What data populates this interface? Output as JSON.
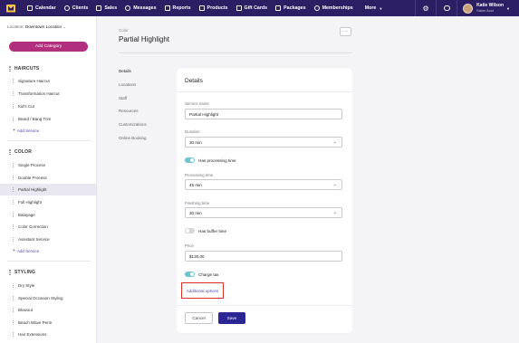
{
  "nav": {
    "items": [
      {
        "label": "Calendar",
        "icon": "calendar-icon"
      },
      {
        "label": "Clients",
        "icon": "clients-icon"
      },
      {
        "label": "Sales",
        "icon": "sales-icon"
      },
      {
        "label": "Messages",
        "icon": "messages-icon"
      },
      {
        "label": "Reports",
        "icon": "reports-icon"
      },
      {
        "label": "Products",
        "icon": "products-icon"
      },
      {
        "label": "Gift Cards",
        "icon": "gift-card-icon"
      },
      {
        "label": "Packages",
        "icon": "packages-icon"
      },
      {
        "label": "Memberships",
        "icon": "memberships-icon"
      }
    ],
    "more": "More",
    "user_name": "Katie Wilson",
    "user_role": "Salon Acct"
  },
  "sidebar": {
    "location_label": "Location:",
    "location_value": "Downtown Location",
    "add_category": "Add Category",
    "sections": [
      {
        "title": "HAIRCUTS",
        "items": [
          "Signature Haircut",
          "Transformation Haircut",
          "Kid's Cut",
          "Beard / Bang Trim"
        ],
        "add": "Add Service"
      },
      {
        "title": "COLOR",
        "items": [
          "Single Process",
          "Double Process",
          "Partial Highlight",
          "Full Highlight",
          "Balayage",
          "Color Correction",
          "Assistant Service"
        ],
        "add": "Add Service"
      },
      {
        "title": "STYLING",
        "items": [
          "Dry Style",
          "Special Occasion Styling",
          "Blowout",
          "Beach Wave Perm",
          "Hair Extensions"
        ]
      }
    ],
    "active_item": "Partial Highlight"
  },
  "main": {
    "breadcrumb": "Color",
    "title": "Partial Highlight",
    "more_button": "···",
    "subnav": [
      "Details",
      "Locations",
      "Staff",
      "Resources",
      "Customizations",
      "Online Booking"
    ],
    "details": {
      "heading": "Details",
      "service_name_label": "Service name",
      "service_name_value": "Partial Highlight",
      "duration_label": "Duration",
      "duration_value": "30 min",
      "has_processing_label": "Has processing time",
      "has_processing_on": true,
      "processing_label": "Processing time",
      "processing_value": "45 min",
      "finishing_label": "Finishing time",
      "finishing_value": "30 min",
      "has_buffer_label": "Has buffer time",
      "has_buffer_on": false,
      "price_label": "Price",
      "price_value": "$130.00",
      "charge_tax_label": "Charge tax",
      "charge_tax_on": true,
      "additional_options": "Additional options",
      "cancel": "Cancel",
      "save": "Save"
    }
  },
  "colors": {
    "nav_bg": "#2b1e63",
    "accent_pink": "#b0307e",
    "primary_button": "#2b2693",
    "toggle_on": "#6cc5d4",
    "highlight_box": "#d9302a"
  }
}
